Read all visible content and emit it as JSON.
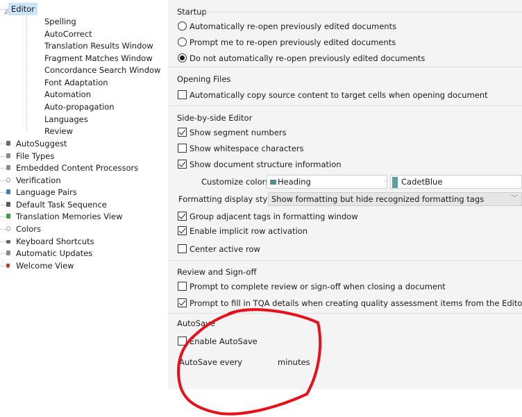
{
  "tree": {
    "root": {
      "label": "Editor",
      "icon": "editor-icon"
    },
    "editor_children": [
      "Spelling",
      "AutoCorrect",
      "Translation Results Window",
      "Fragment Matches Window",
      "Concordance Search Window",
      "Font Adaptation",
      "Automation",
      "Auto-propagation",
      "Languages",
      "Review"
    ],
    "items": [
      {
        "label": "AutoSuggest",
        "icon": "autosuggest-icon",
        "color": "#6b6b6b"
      },
      {
        "label": "File Types",
        "icon": "file-types-icon",
        "color": "#8a8a8a"
      },
      {
        "label": "Embedded Content Processors",
        "icon": "embedded-content-icon",
        "color": "#8a8a8a"
      },
      {
        "label": "Verification",
        "icon": "verification-icon",
        "color": "#9a9a9a"
      },
      {
        "label": "Language Pairs",
        "icon": "language-pairs-icon",
        "color": "#3d7fc1"
      },
      {
        "label": "Default Task Sequence",
        "icon": "task-sequence-icon",
        "color": "#5a5a5a"
      },
      {
        "label": "Translation Memories View",
        "icon": "translation-memories-icon",
        "color": "#3aa14a"
      },
      {
        "label": "Colors",
        "icon": "colors-icon",
        "color": "#9a9a9a"
      },
      {
        "label": "Keyboard Shortcuts",
        "icon": "keyboard-icon",
        "color": "#6b6b6b"
      },
      {
        "label": "Automatic Updates",
        "icon": "updates-icon",
        "color": "#8a8a8a"
      },
      {
        "label": "Welcome View",
        "icon": "welcome-icon",
        "color": "#c0392b"
      }
    ]
  },
  "startup": {
    "title": "Startup",
    "options": [
      {
        "label": "Automatically re-open previously edited documents",
        "selected": false
      },
      {
        "label": "Prompt me to re-open previously edited documents",
        "selected": false
      },
      {
        "label": "Do not automatically re-open previously edited documents",
        "selected": true
      }
    ]
  },
  "opening_files": {
    "title": "Opening Files",
    "copy_source": {
      "label": "Automatically copy source content to target cells when opening document",
      "checked": false
    }
  },
  "side_by_side": {
    "title": "Side-by-side Editor",
    "show_segment_numbers": {
      "label": "Show segment numbers",
      "checked": true
    },
    "show_whitespace": {
      "label": "Show whitespace characters",
      "checked": false
    },
    "show_structure": {
      "label": "Show document structure information",
      "checked": true
    },
    "customize_colors_label": "Customize colors:",
    "heading_color": {
      "value": "Heading",
      "swatch": "#4f8f8f"
    },
    "cadetblue_color": {
      "value": "CadetBlue",
      "swatch": "#5f9ea0"
    },
    "formatting_label": "Formatting display style:",
    "formatting_value": "Show formatting but hide recognized formatting tags",
    "group_tags": {
      "label": "Group adjacent tags in formatting window",
      "checked": true
    },
    "implicit_row": {
      "label": "Enable implicit row activation",
      "checked": true
    },
    "center_row": {
      "label": "Center active row",
      "checked": false
    }
  },
  "review": {
    "title": "Review and Sign-off",
    "prompt_complete": {
      "label": "Prompt to complete review or sign-off when closing a document",
      "checked": false
    },
    "prompt_tqa": {
      "label": "Prompt to fill in TQA details when creating quality assessment items from the Editor",
      "checked": true
    }
  },
  "autosave": {
    "title": "AutoSave",
    "enable": {
      "label": "Enable AutoSave",
      "checked": false
    },
    "every_label": "AutoSave every",
    "minutes_label": "minutes"
  },
  "colors": {
    "annotation": "#e8101a",
    "selection": "#cce4f7",
    "panel_bg": "#f4f4f4"
  }
}
